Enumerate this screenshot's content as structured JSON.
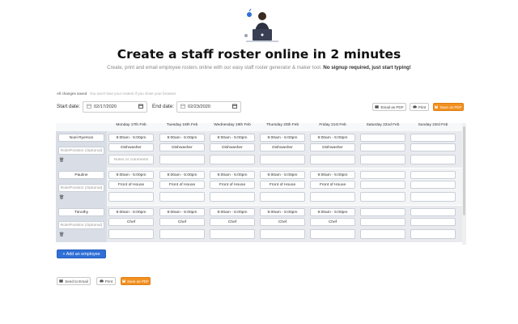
{
  "hero": {
    "title": "Create a staff roster online in 2 minutes",
    "subtitle_text": "Create, print and email employee rosters online with our easy staff roster generator & maker tool.",
    "subtitle_bold": "No signup required, just start typing!"
  },
  "status": {
    "saved": "All changes saved",
    "hint": "You won't lose your rosters if you close your browser"
  },
  "dates": {
    "start_label": "Start date:",
    "start_value": "02/17/2020",
    "end_label": "End date:",
    "end_value": "02/23/2020"
  },
  "toolbar": {
    "email_pdf": "Email as PDF",
    "print": "Print",
    "save_pdf": "Save as PDF"
  },
  "days": [
    "Monday 17th Feb",
    "Tuesday 18th Feb",
    "Wednesday 19th Feb",
    "Thursday 20th Feb",
    "Friday 21st Feb",
    "Saturday 22nd Feb",
    "Sunday 23rd Feb"
  ],
  "employees": [
    {
      "name": "Noel Ryerson",
      "role_placeholder": "Role/Position (Optional)",
      "shifts": [
        {
          "time": "9:00am - 5:00pm",
          "role": "Dishwasher",
          "notes": "Notes or comments"
        },
        {
          "time": "9:00am - 5:00pm",
          "role": "Dishwasher",
          "notes": ""
        },
        {
          "time": "9:00am - 5:00pm",
          "role": "Dishwasher",
          "notes": ""
        },
        {
          "time": "9:00am - 5:00pm",
          "role": "Dishwasher",
          "notes": ""
        },
        {
          "time": "9:00am - 5:00pm",
          "role": "Dishwasher",
          "notes": ""
        },
        {
          "time": "",
          "role": "",
          "notes": ""
        },
        {
          "time": "",
          "role": "",
          "notes": ""
        }
      ]
    },
    {
      "name": "Pauline",
      "role_placeholder": "Role/Position (Optional)",
      "shifts": [
        {
          "time": "9:00am - 5:00pm",
          "role": "Front of House",
          "notes": ""
        },
        {
          "time": "9:00am - 5:00pm",
          "role": "Front of House",
          "notes": ""
        },
        {
          "time": "9:00am - 5:00pm",
          "role": "Front of House",
          "notes": ""
        },
        {
          "time": "9:00am - 5:00pm",
          "role": "Front of House",
          "notes": ""
        },
        {
          "time": "9:00am - 5:00pm",
          "role": "Front of House",
          "notes": ""
        },
        {
          "time": "",
          "role": "",
          "notes": ""
        },
        {
          "time": "",
          "role": "",
          "notes": ""
        }
      ]
    },
    {
      "name": "Timothy",
      "role_placeholder": "Role/Position (Optional)",
      "shifts": [
        {
          "time": "9:00am - 5:00pm",
          "role": "Chef",
          "notes": ""
        },
        {
          "time": "9:00am - 5:00pm",
          "role": "Chef",
          "notes": ""
        },
        {
          "time": "9:00am - 5:00pm",
          "role": "Chef",
          "notes": ""
        },
        {
          "time": "9:00am - 5:00pm",
          "role": "Chef",
          "notes": ""
        },
        {
          "time": "9:00am - 5:00pm",
          "role": "Chef",
          "notes": ""
        },
        {
          "time": "",
          "role": "",
          "notes": ""
        },
        {
          "time": "",
          "role": "",
          "notes": ""
        }
      ]
    }
  ],
  "add_employee": "+ Add an employee",
  "bottom_toolbar": {
    "send_email": "Send to Email",
    "print": "Print",
    "save_pdf": "Save as PDF"
  },
  "colors": {
    "accent_orange": "#f29021",
    "accent_blue": "#2f6fd6",
    "employee_column": "#d9dee6"
  },
  "icons": [
    "calendar-icon",
    "envelope-icon",
    "printer-icon",
    "save-icon",
    "trash-icon"
  ]
}
